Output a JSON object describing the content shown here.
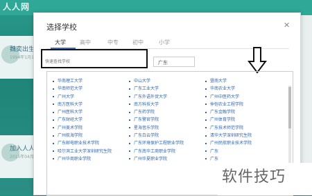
{
  "background": {
    "logo": "人人网",
    "cards": [
      {
        "title": "魏奕出生",
        "subtitle": "1994年1月1日"
      },
      {
        "title": "加入人人",
        "subtitle": "2015年04月"
      }
    ]
  },
  "dialog": {
    "title": "选择学校",
    "close": "✕",
    "tabs": [
      "大学",
      "高中",
      "中专",
      "初中",
      "小学"
    ],
    "active_tab": "大学",
    "search_placeholder": "快速查找学校",
    "province": "广东",
    "columns": [
      [
        "华南理工大学",
        "华南师范大学",
        "广州大学",
        "南方医科大学",
        "广州医科大学",
        "广东财经大学",
        "广州美术学院",
        "广州航海学院",
        "广东邮电职业技术学院",
        "哈尔滨工业大学深圳研究生院",
        "广州华商职业学院"
      ],
      [
        "中山大学",
        "广东工业大学",
        "广东外语外贸大学",
        "南方科技大学",
        "广东药学院",
        "广东警官学院",
        "星海音乐学院",
        "广东白云学院",
        "广东环境保护工程职业学院",
        "广东南华工商职业学院",
        "广州华夏职业学院"
      ],
      [
        "暨南大学",
        "华南农业大学",
        "广州中医药大学",
        "仲恺农业工程学院",
        "广东金融学院",
        "广州体育学院",
        "广东技术师范学院",
        "清华大学深圳研究生院",
        "广州民航职业技术学院",
        "广东",
        "广东"
      ]
    ]
  },
  "watermark": "软件技巧"
}
